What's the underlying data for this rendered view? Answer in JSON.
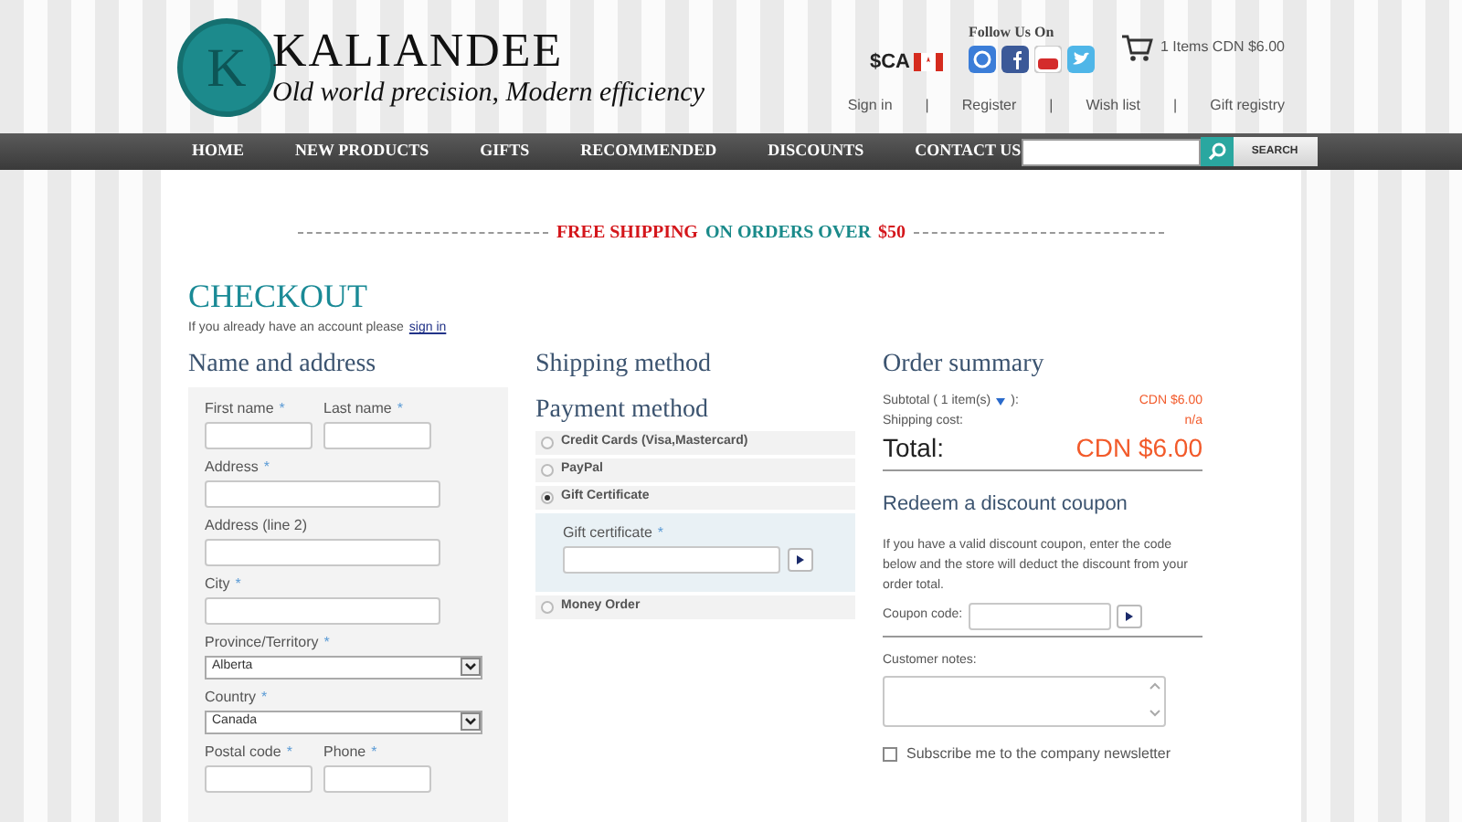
{
  "header": {
    "logo_letter": "K",
    "brand": "KALIANDEE",
    "tagline": "Old world precision, Modern efficiency",
    "currency": "$CA",
    "follow_label": "Follow Us On",
    "cart": "1 Items CDN $6.00",
    "separator": "|",
    "account_links": [
      "Sign in",
      "Register",
      "Wish list",
      "Gift registry"
    ]
  },
  "nav": {
    "items": [
      "HOME",
      "NEW PRODUCTS",
      "GIFTS",
      "RECOMMENDED",
      "DISCOUNTS",
      "CONTACT US"
    ],
    "search_button": "SEARCH"
  },
  "banner": {
    "parts": [
      {
        "text": "FREE SHIPPING",
        "color": "#d4161b"
      },
      {
        "text": "ON ORDERS OVER",
        "color": "#1a8a8a"
      },
      {
        "text": "$50",
        "color": "#d4161b"
      }
    ]
  },
  "checkout": {
    "title": "CHECKOUT",
    "intro": "If you already have an account please",
    "sign_in_link": "sign in"
  },
  "address": {
    "title": "Name and address",
    "rows": [
      [
        {
          "kind": "text",
          "label": "First name",
          "mark": "*"
        },
        {
          "kind": "text",
          "label": "Last name",
          "mark": "*"
        }
      ],
      [
        {
          "kind": "text",
          "label": "Address",
          "mark": "*"
        }
      ],
      [
        {
          "kind": "text",
          "label": "Address (line 2)"
        }
      ],
      [
        {
          "kind": "text",
          "label": "City",
          "mark": "*"
        }
      ],
      [
        {
          "kind": "select",
          "label": "Province/Territory",
          "mark": "*",
          "value": "Alberta"
        }
      ],
      [
        {
          "kind": "select",
          "label": "Country",
          "mark": "*",
          "value": "Canada"
        }
      ],
      [
        {
          "kind": "text",
          "label": "Postal code",
          "mark": "*"
        },
        {
          "kind": "text",
          "label": "Phone",
          "mark": "*"
        }
      ]
    ]
  },
  "shipping": {
    "title": "Shipping method"
  },
  "payment": {
    "title": "Payment method",
    "methods": [
      {
        "label": "Credit Cards (Visa,Mastercard)",
        "selected": false
      },
      {
        "label": "PayPal",
        "selected": false
      },
      {
        "label": "Gift Certificate",
        "selected": true,
        "field": {
          "label": "Gift certificate",
          "mark": "*"
        }
      },
      {
        "label": "Money Order",
        "selected": false
      }
    ]
  },
  "summary": {
    "title": "Order summary",
    "subtotal_label": "Subtotal ( 1 item(s)",
    "subtotal_end": "):",
    "subtotal": "CDN $6.00",
    "shipping_label": "Shipping cost:",
    "shipping": "n/a",
    "total_label": "Total:",
    "total": "CDN $6.00"
  },
  "coupon": {
    "title": "Redeem a discount coupon",
    "text": "If you have a valid discount coupon, enter the code below and the store will deduct the discount from your order total.",
    "label": "Coupon code:"
  },
  "notes": {
    "label": "Customer notes:"
  },
  "newsletter": {
    "label": "Subscribe me to the company newsletter",
    "checked": false
  }
}
